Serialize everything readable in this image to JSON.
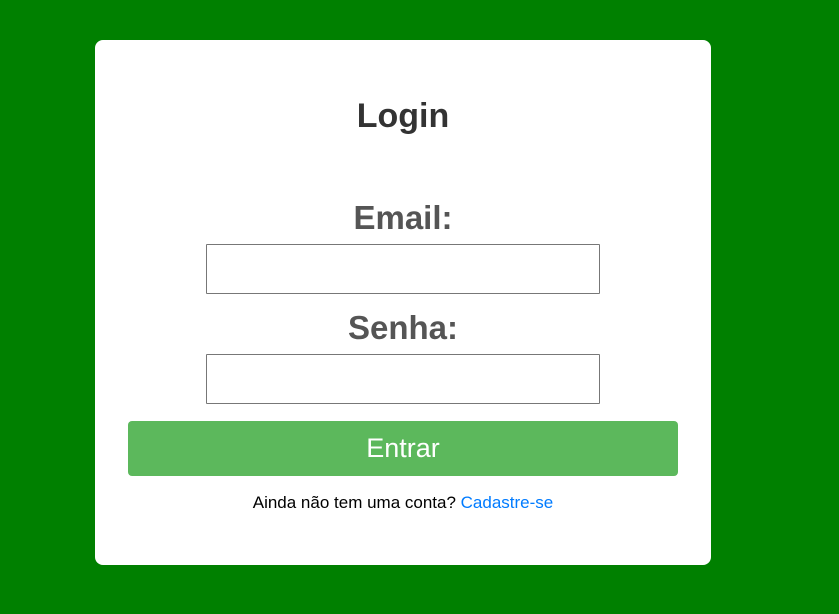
{
  "login": {
    "title": "Login",
    "email_label": "Email:",
    "email_value": "",
    "password_label": "Senha:",
    "password_value": "",
    "submit_label": "Entrar",
    "signup_prompt": "Ainda não tem uma conta?",
    "signup_link": "Cadastre-se"
  },
  "colors": {
    "background": "#008000",
    "card": "#ffffff",
    "button": "#5cb85c",
    "link": "#007bff"
  }
}
